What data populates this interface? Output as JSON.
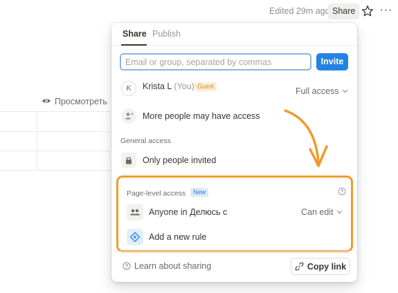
{
  "topbar": {
    "edited": "Edited 29m ago",
    "share_label": "Share",
    "star_icon": "star-icon",
    "more_icon": "more-horizontal-icon",
    "more_glyph": "···"
  },
  "background": {
    "preview_label": "Просмотреть",
    "preview_icon": "eye-icon"
  },
  "popover": {
    "tabs": [
      {
        "label": "Share",
        "active": true
      },
      {
        "label": "Publish",
        "active": false
      }
    ],
    "email": {
      "value": "",
      "placeholder": "Email or group, separated by commas"
    },
    "invite_label": "Invite",
    "member": {
      "avatar_initial": "K",
      "name": "Krista L",
      "you": "(You)",
      "badge": "Guest",
      "access": "Full access"
    },
    "more_people": "More people may have access",
    "general_access_label": "General access",
    "general_access_value": "Only people invited",
    "page_level": {
      "label": "Page-level access",
      "badge": "New",
      "rule_target": "Anyone in Делюсь с",
      "rule_access": "Can edit",
      "add_rule": "Add a new rule"
    },
    "learn_label": "Learn about sharing",
    "copy_link_label": "Copy link"
  },
  "colors": {
    "accent": "#2383e2",
    "highlight": "#f09a2c",
    "guest_badge_bg": "#fbecd6",
    "new_badge_bg": "#ddebf7"
  }
}
